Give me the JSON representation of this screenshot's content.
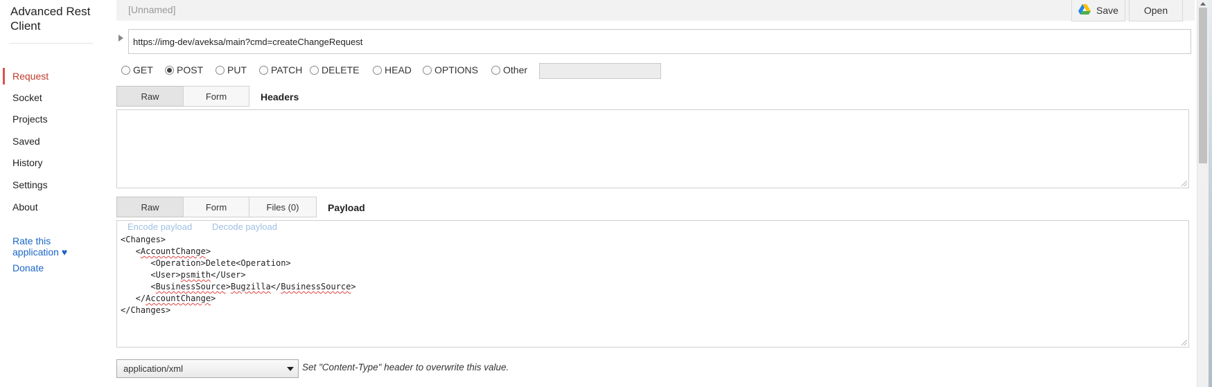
{
  "app": {
    "title": "Advanced Rest Client"
  },
  "sidebar": {
    "items": [
      {
        "label": "Request",
        "active": true
      },
      {
        "label": "Socket"
      },
      {
        "label": "Projects"
      },
      {
        "label": "Saved"
      },
      {
        "label": "History"
      },
      {
        "label": "Settings"
      },
      {
        "label": "About"
      }
    ],
    "rate_link": "Rate this application ♥",
    "donate_link": "Donate",
    "accent_color": "#d9534f"
  },
  "request": {
    "name": "[Unnamed]",
    "save_label": "Save",
    "open_label": "Open",
    "url": "https://img-dev/aveksa/main?cmd=createChangeRequest",
    "methods": [
      "GET",
      "POST",
      "PUT",
      "PATCH",
      "DELETE",
      "HEAD",
      "OPTIONS",
      "Other"
    ],
    "selected_method": "POST"
  },
  "headers": {
    "tabs": [
      "Raw",
      "Form"
    ],
    "active_tab": "Raw",
    "title": "Headers"
  },
  "payload": {
    "tabs": [
      "Raw",
      "Form",
      "Files (0)"
    ],
    "active_tab": "Raw",
    "title": "Payload",
    "encode_label": "Encode payload",
    "decode_label": "Decode payload",
    "lines": [
      "<Changes>",
      "   <AccountChange>",
      "      <Operation>Delete<Operation>",
      "      <User>psmith</User>",
      "      <BusinessSource>Bugzilla</BusinessSource>",
      "   </AccountChange>",
      "</Changes>"
    ],
    "content_type": "application/xml",
    "content_type_hint": "Set \"Content-Type\" header to overwrite this value."
  },
  "icons": {
    "save": "google-drive-icon",
    "dropdown": "chevron-down-icon"
  }
}
